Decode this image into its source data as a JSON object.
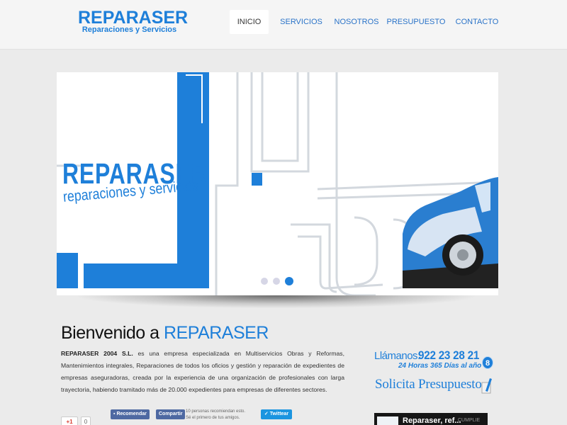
{
  "logo": {
    "main": "REPARASER",
    "sub": "Reparaciones y Servicios"
  },
  "nav": {
    "items": [
      {
        "label": "INICIO"
      },
      {
        "label": "SERVICIOS"
      },
      {
        "label": "NOSOTROS"
      },
      {
        "label": "PRESUPUESTO"
      },
      {
        "label": "CONTACTO"
      }
    ],
    "active": "INICIO"
  },
  "slider": {
    "brand": "REPARASER",
    "tagline": "reparaciones y servicios",
    "slide_count": 3,
    "active_slide": 3
  },
  "welcome": {
    "title_prefix": "Bienvenido a ",
    "title_brand": "REPARASER",
    "company": "REPARASER 2004 S.L.",
    "text": " es una empresa especializada en Multiservicios Obras y Reformas, Mantenimientos integrales, Reparaciones de todos los oficios y gestión y reparación de expedientes de empresas aseguradoras, creada por la experiencia de una organización de profesionales con larga trayectoria, habiendo tramitado más de 20.000 expedientes para empresas de diferentes sectores."
  },
  "social": {
    "gplus_label": "+1",
    "gplus_count": "0",
    "fb_recommend": "Recomendar",
    "fb_share": "Compartir",
    "fb_text_line1": "10 personas recomiendan esto.",
    "fb_text_line2": "Sé el primero de tus amigos.",
    "twitter_label": "Twittear"
  },
  "contact": {
    "call_label": "Llámanos:",
    "phone": "922 23 28 21",
    "hours": "24 Horas 365 Días al año",
    "badge": "8",
    "quote_link": "Solicita Presupuesto"
  },
  "video": {
    "title": "Reparaser, ref...",
    "tag": "CUMPLIE"
  },
  "colors": {
    "accent": "#1e7fd9",
    "background": "#ebebeb",
    "header": "#f5f5f5"
  }
}
